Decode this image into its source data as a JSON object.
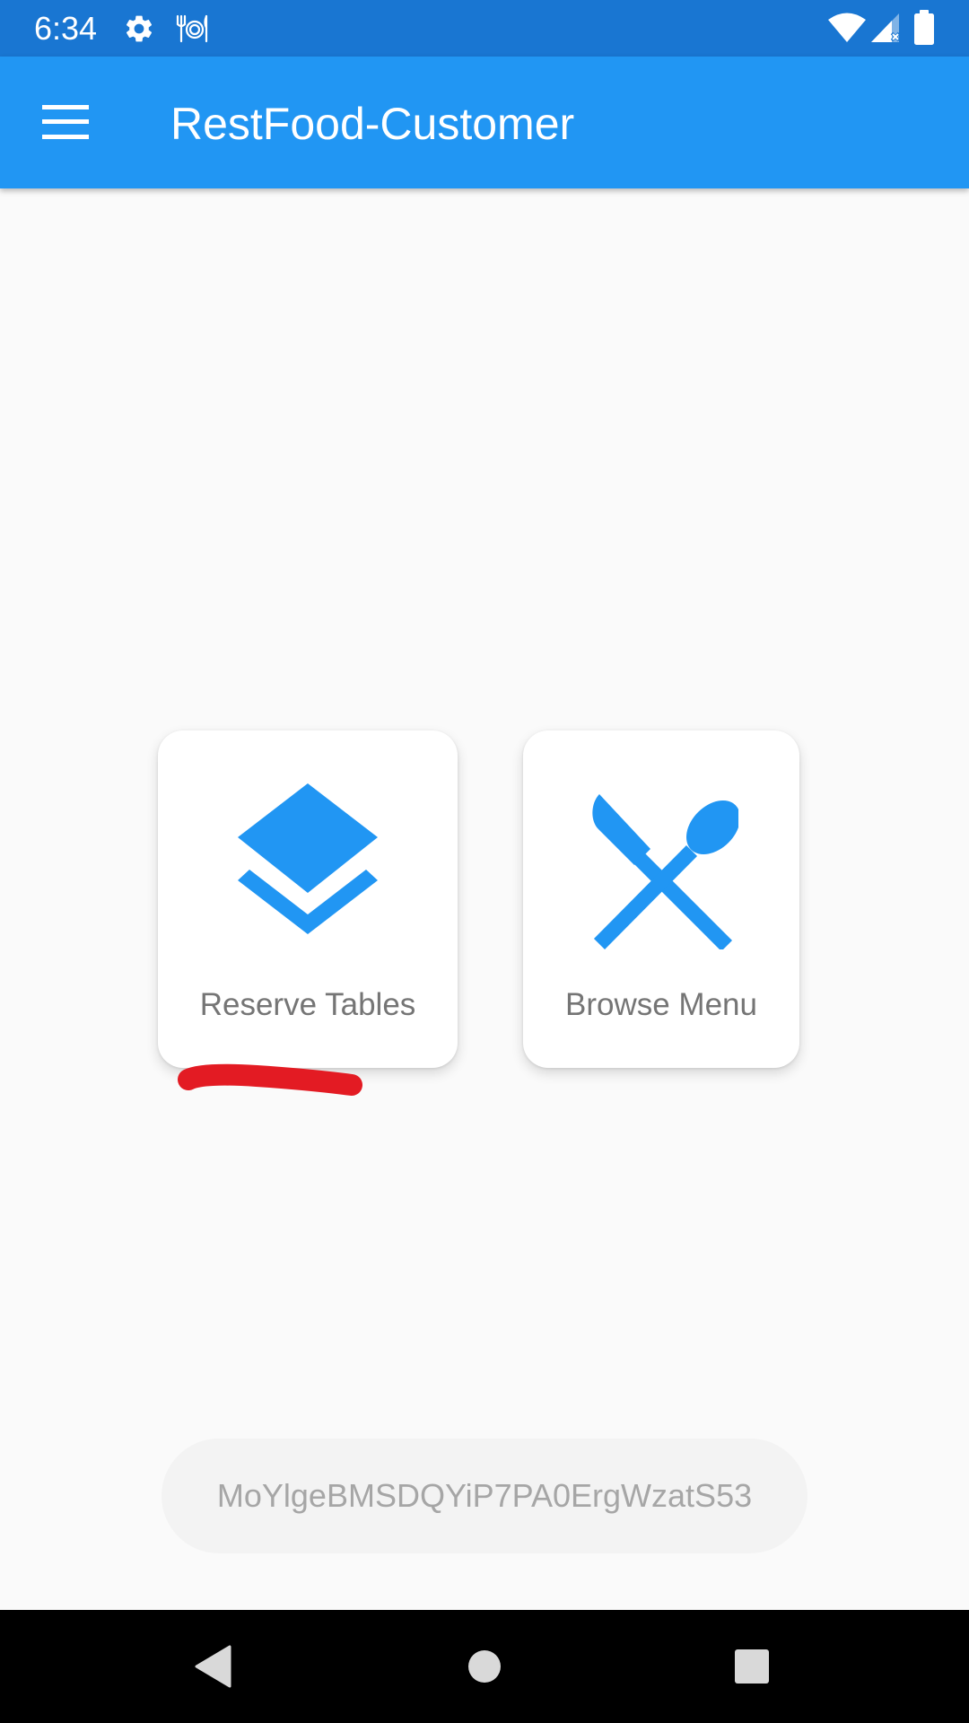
{
  "status_bar": {
    "time": "6:34",
    "left_icons": [
      "gear-icon",
      "restaurant-icon"
    ],
    "right_icons": [
      "wifi-icon",
      "signal-icon",
      "battery-icon"
    ]
  },
  "app_bar": {
    "title": "RestFood-Customer",
    "menu_icon": "hamburger-menu-icon",
    "color": "#2196f3"
  },
  "cards": [
    {
      "label": "Reserve Tables",
      "icon": "layers-icon"
    },
    {
      "label": "Browse Menu",
      "icon": "fork-knife-icon"
    }
  ],
  "user_id": "MoYlgeBMSDQYiP7PA0ErgWzatS53",
  "nav_bar": {
    "buttons": [
      "back-icon",
      "home-icon",
      "recents-icon"
    ]
  },
  "colors": {
    "status_bar": "#1976d2",
    "accent": "#2196f3",
    "annotation": "#e31b23",
    "background": "#fafafa"
  }
}
